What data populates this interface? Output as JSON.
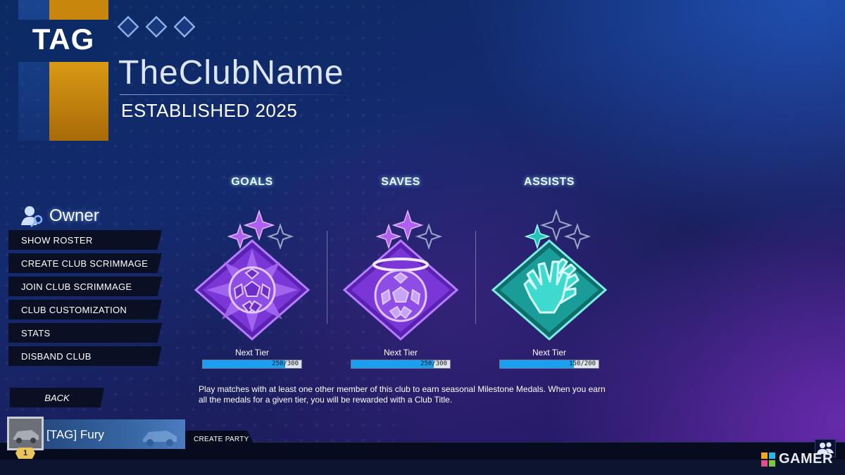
{
  "club": {
    "tag": "TAG",
    "name": "TheClubName",
    "established": "ESTABLISHED 2025",
    "colors": {
      "primary": "#0c2a66",
      "accent": "#d99a14"
    },
    "rank_diamonds": 3
  },
  "role": {
    "label": "Owner",
    "icon": "owner-key-icon"
  },
  "menu": {
    "items": [
      {
        "label": "SHOW ROSTER"
      },
      {
        "label": "CREATE CLUB SCRIMMAGE"
      },
      {
        "label": "JOIN CLUB SCRIMMAGE"
      },
      {
        "label": "CLUB CUSTOMIZATION"
      },
      {
        "label": "STATS"
      },
      {
        "label": "DISBAND CLUB"
      }
    ],
    "back_label": "BACK"
  },
  "medals": [
    {
      "title": "GOALS",
      "next_tier_label": "Next Tier",
      "progress_text": "250/300",
      "current": 250,
      "target": 300,
      "color": "#8a3fe0",
      "icon": "soccer-ball-icon",
      "stars_lit": 2
    },
    {
      "title": "SAVES",
      "next_tier_label": "Next Tier",
      "progress_text": "250/300",
      "current": 250,
      "target": 300,
      "color": "#8a3fe0",
      "icon": "haloed-ball-icon",
      "stars_lit": 2
    },
    {
      "title": "ASSISTS",
      "next_tier_label": "Next Tier",
      "progress_text": "150/200",
      "current": 150,
      "target": 200,
      "color": "#1fb8b0",
      "icon": "high-five-icon",
      "stars_lit": 1
    }
  ],
  "description": "Play matches with at least one other member of this club to earn seasonal Milestone Medals. When you earn all the medals for a given tier, you will be rewarded with a Club Title.",
  "player": {
    "name": "[TAG] Fury",
    "level": "1",
    "create_party_label": "CREATE PARTY"
  },
  "watermark": {
    "text": "GAMER"
  }
}
